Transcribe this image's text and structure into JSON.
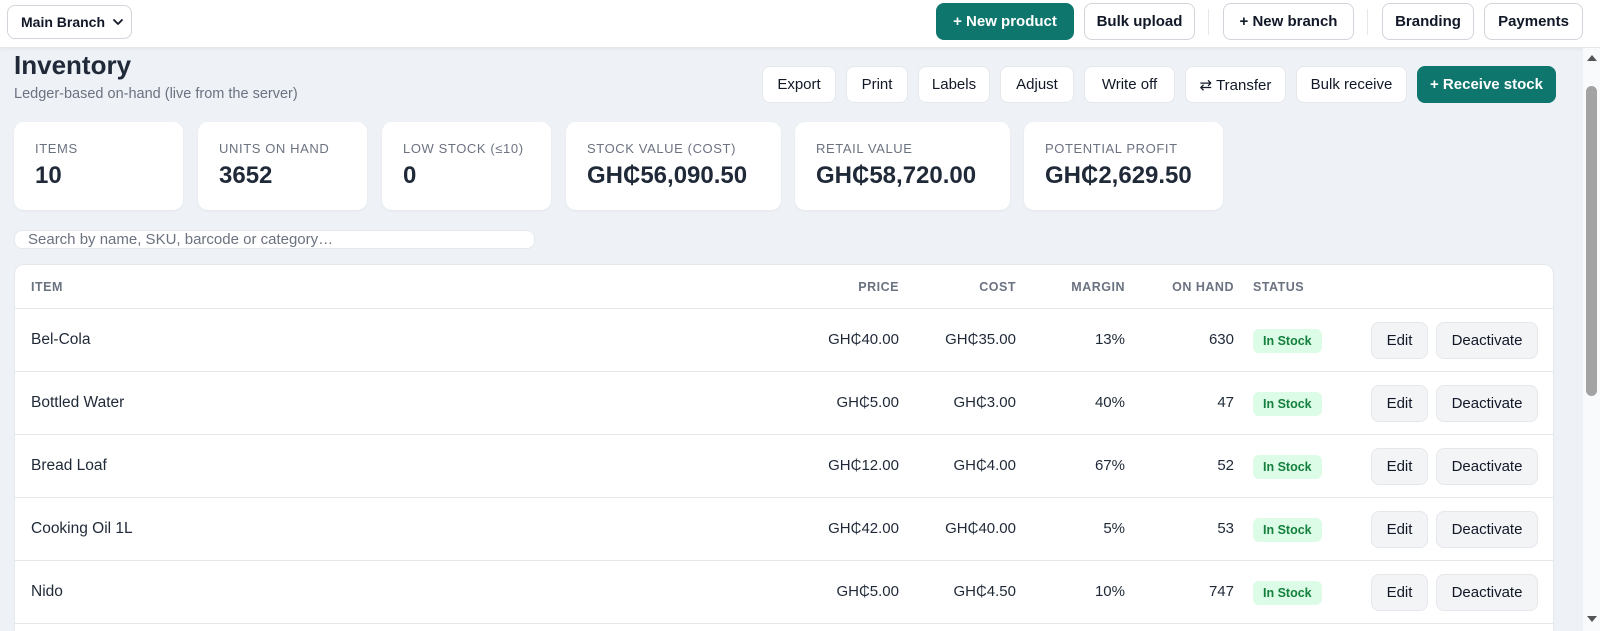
{
  "topbar": {
    "branch": "Main Branch",
    "new_product": "+ New product",
    "bulk_upload": "Bulk upload",
    "new_branch": "+ New branch",
    "branding": "Branding",
    "payments": "Payments"
  },
  "page": {
    "title": "Inventory",
    "subtitle": "Ledger-based on-hand (live from the server)"
  },
  "actions": {
    "export": "Export",
    "print": "Print",
    "labels": "Labels",
    "adjust": "Adjust",
    "write_off": "Write off",
    "transfer": "⇄ Transfer",
    "bulk_receive": "Bulk receive",
    "receive_stock": "+ Receive stock"
  },
  "stats": {
    "items": {
      "label": "ITEMS",
      "value": "10"
    },
    "units": {
      "label": "UNITS ON HAND",
      "value": "3652"
    },
    "low": {
      "label": "LOW STOCK (≤10)",
      "value": "0"
    },
    "stock_value": {
      "label": "STOCK VALUE (COST)",
      "value": "GH₵56,090.50"
    },
    "retail_value": {
      "label": "RETAIL VALUE",
      "value": "GH₵58,720.00"
    },
    "profit": {
      "label": "POTENTIAL PROFIT",
      "value": "GH₵2,629.50"
    }
  },
  "search": {
    "placeholder": "Search by name, SKU, barcode or category…"
  },
  "table": {
    "headers": {
      "item": "ITEM",
      "price": "PRICE",
      "cost": "COST",
      "margin": "MARGIN",
      "on_hand": "ON HAND",
      "status": "STATUS"
    },
    "edit_label": "Edit",
    "deactivate_label": "Deactivate",
    "rows": [
      {
        "name": "Bel-Cola",
        "price": "GH₵40.00",
        "cost": "GH₵35.00",
        "margin": "13%",
        "on_hand": "630",
        "status": "In Stock"
      },
      {
        "name": "Bottled Water",
        "price": "GH₵5.00",
        "cost": "GH₵3.00",
        "margin": "40%",
        "on_hand": "47",
        "status": "In Stock"
      },
      {
        "name": "Bread Loaf",
        "price": "GH₵12.00",
        "cost": "GH₵4.00",
        "margin": "67%",
        "on_hand": "52",
        "status": "In Stock"
      },
      {
        "name": "Cooking Oil 1L",
        "price": "GH₵42.00",
        "cost": "GH₵40.00",
        "margin": "5%",
        "on_hand": "53",
        "status": "In Stock"
      },
      {
        "name": "Nido",
        "price": "GH₵5.00",
        "cost": "GH₵4.50",
        "margin": "10%",
        "on_hand": "747",
        "status": "In Stock"
      }
    ]
  },
  "colors": {
    "accent": "#0f766e",
    "badge_bg": "#dcfce7",
    "badge_text": "#15803d"
  }
}
